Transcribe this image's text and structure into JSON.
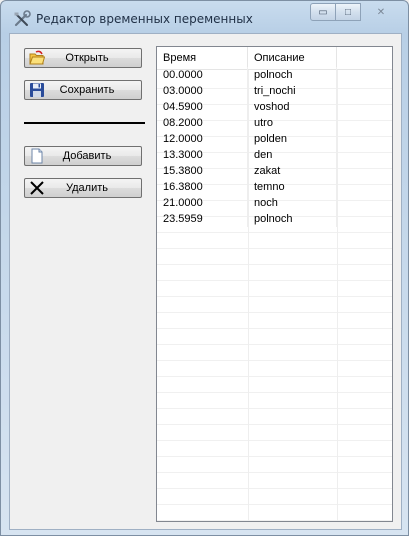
{
  "window": {
    "title": "Редактор временных переменных",
    "icon": "tools-icon",
    "controls": {
      "minimize": "▭",
      "maximize": "□",
      "close": "✕"
    }
  },
  "toolbar": {
    "open_label": "Открыть",
    "save_label": "Сохранить",
    "add_label": "Добавить",
    "delete_label": "Удалить"
  },
  "table": {
    "columns": [
      "Время",
      "Описание"
    ],
    "rows": [
      {
        "time": "00.0000",
        "desc": "polnoch"
      },
      {
        "time": "03.0000",
        "desc": "tri_nochi"
      },
      {
        "time": "04.5900",
        "desc": "voshod"
      },
      {
        "time": "08.2000",
        "desc": "utro"
      },
      {
        "time": "12.0000",
        "desc": "polden"
      },
      {
        "time": "13.3000",
        "desc": "den"
      },
      {
        "time": "15.3800",
        "desc": "zakat"
      },
      {
        "time": "16.3800",
        "desc": "temno"
      },
      {
        "time": "21.0000",
        "desc": "noch"
      },
      {
        "time": "23.5959",
        "desc": "polnoch"
      }
    ]
  },
  "colors": {
    "title_bar": "#b8cfe6",
    "client": "#f0f0f0",
    "grid": "#eeeeee"
  }
}
